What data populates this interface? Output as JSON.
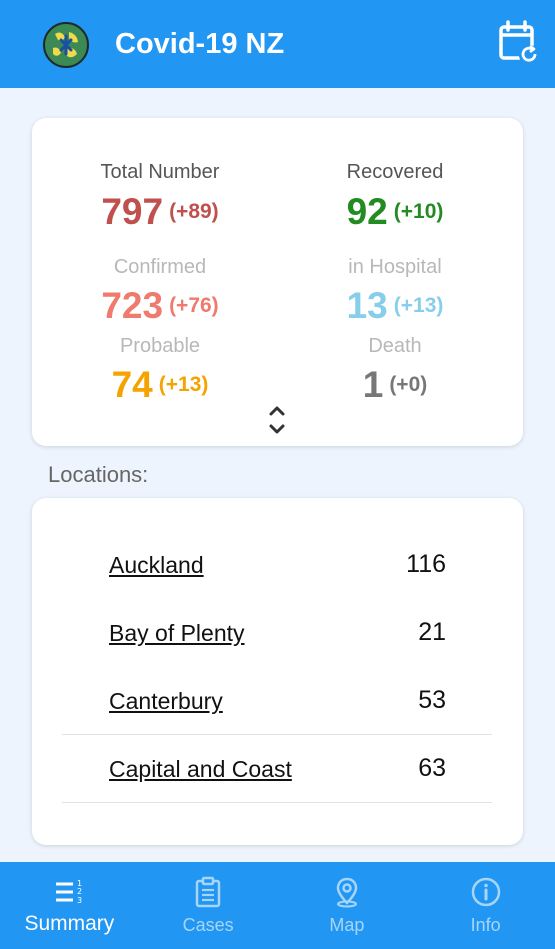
{
  "app": {
    "title": "Covid-19 NZ",
    "logo_icon": "virus-globe-logo",
    "action_icon": "calendar-refresh-icon"
  },
  "summary": {
    "stats": [
      {
        "label": "Total Number",
        "value": "797",
        "delta": "(+89)",
        "label_color": "#555555",
        "value_color": "#c0504d"
      },
      {
        "label": "Recovered",
        "value": "92",
        "delta": "(+10)",
        "label_color": "#555555",
        "value_color": "#228b22"
      },
      {
        "label": "Confirmed",
        "value": "723",
        "delta": "(+76)",
        "label_color": "#b8b8b8",
        "value_color": "#ef7a6e"
      },
      {
        "label": "in Hospital",
        "value": "13",
        "delta": "(+13)",
        "label_color": "#b8b8b8",
        "value_color": "#87ceeb"
      },
      {
        "label": "Probable",
        "value": "74",
        "delta": "(+13)",
        "label_color": "#b8b8b8",
        "value_color": "#f5a300"
      },
      {
        "label": "Death",
        "value": "1",
        "delta": "(+0)",
        "label_color": "#b8b8b8",
        "value_color": "#777777"
      }
    ],
    "expand_icon": "chevron-up-down-icon"
  },
  "locations": {
    "heading": "Locations:",
    "rows": [
      {
        "name": "Auckland",
        "count": "116"
      },
      {
        "name": "Bay of Plenty",
        "count": "21"
      },
      {
        "name": "Canterbury",
        "count": "53"
      },
      {
        "name": "Capital and Coast",
        "count": "63"
      }
    ]
  },
  "nav": {
    "items": [
      {
        "label": "Summary",
        "icon": "list-numbered-icon",
        "active": true
      },
      {
        "label": "Cases",
        "icon": "clipboard-list-icon",
        "active": false
      },
      {
        "label": "Map",
        "icon": "map-pin-icon",
        "active": false
      },
      {
        "label": "Info",
        "icon": "info-icon",
        "active": false
      }
    ]
  },
  "colors": {
    "primary": "#2196f3",
    "background": "#eef4fd"
  }
}
